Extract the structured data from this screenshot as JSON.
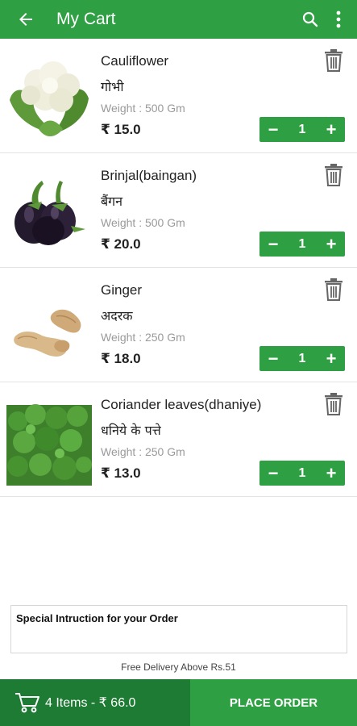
{
  "appbar": {
    "title": "My Cart",
    "icons": [
      "back-arrow-icon",
      "search-icon",
      "more-vert-icon"
    ]
  },
  "cart": {
    "items": [
      {
        "name": "Cauliflower",
        "hindi": "गोभी",
        "weight": "Weight : 500 Gm",
        "price": "₹ 15.0",
        "qty": "1"
      },
      {
        "name": "Brinjal(baingan)",
        "hindi": "बैंगन",
        "weight": "Weight : 500 Gm",
        "price": "₹ 20.0",
        "qty": "1"
      },
      {
        "name": "Ginger",
        "hindi": "अदरक",
        "weight": "Weight : 250 Gm",
        "price": "₹ 18.0",
        "qty": "1"
      },
      {
        "name": "Coriander leaves(dhaniye)",
        "hindi": "धनिये के पत्ते",
        "weight": "Weight : 250 Gm",
        "price": "₹ 13.0",
        "qty": "1"
      }
    ],
    "minus": "−",
    "plus": "+"
  },
  "instruction": {
    "placeholder": "Special Intruction for your Order"
  },
  "delivery_note": "Free Delivery Above Rs.51",
  "bottom": {
    "summary": "4 Items - ₹ 66.0",
    "place_order": "PLACE ORDER"
  },
  "colors": {
    "primary": "#2ea043",
    "dark": "#1e7b34"
  }
}
